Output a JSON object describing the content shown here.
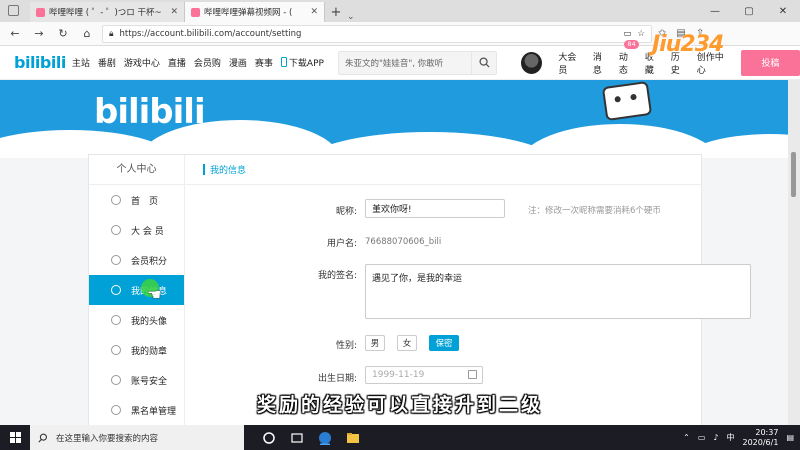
{
  "browser": {
    "tabs": [
      {
        "label": "哔哩哔哩 ( ゜- ゜)つロ 干杯~",
        "active": false
      },
      {
        "label": "哔哩哔哩弹幕视频网 - (",
        "active": true
      }
    ],
    "new_tab": "+",
    "url": "https://account.bilibili.com/account/setting"
  },
  "site_nav": {
    "logo": "bilibili",
    "items": [
      "主站",
      "番剧",
      "游戏中心",
      "直播",
      "会员购",
      "漫画",
      "赛事",
      "下载APP"
    ],
    "search_placeholder": "朱亚文的\"娃娃音\", 你敢听",
    "right_items": [
      "大会员",
      "消息",
      "动态",
      "收藏",
      "历史",
      "创作中心"
    ],
    "dynamic_badge": "84",
    "upload_label": "投稿",
    "watermark": "Jiu234"
  },
  "banner": {
    "logo": "bilibili"
  },
  "sidebar": {
    "title": "个人中心",
    "items": [
      {
        "label": "首　页",
        "icon": "home-icon"
      },
      {
        "label": "大 会 员",
        "icon": "vip-icon"
      },
      {
        "label": "会员积分",
        "icon": "points-icon"
      },
      {
        "label": "我的信息",
        "icon": "user-icon",
        "active": true
      },
      {
        "label": "我的头像",
        "icon": "avatar-icon"
      },
      {
        "label": "我的勋章",
        "icon": "medal-icon"
      },
      {
        "label": "账号安全",
        "icon": "shield-icon"
      },
      {
        "label": "黑名单管理",
        "icon": "blacklist-icon"
      }
    ]
  },
  "profile": {
    "section_title": "我的信息",
    "nickname_label": "昵称:",
    "nickname_value": "堇欢你呀!",
    "nickname_hint": "注：修改一次昵称需要消耗6个硬币",
    "username_label": "用户名:",
    "username_value": "76688070606_bili",
    "signature_label": "我的签名:",
    "signature_value": "遇见了你，是我的幸运",
    "gender_label": "性别:",
    "gender_options": [
      "男",
      "女",
      "保密"
    ],
    "gender_selected": "保密",
    "birthday_label": "出生日期:",
    "birthday_value": "1999-11-19"
  },
  "caption": "奖励的经验可以直接升到二级",
  "taskbar": {
    "search_placeholder": "在这里输入你要搜索的内容",
    "time": "20:37",
    "date": "2020/6/1"
  }
}
